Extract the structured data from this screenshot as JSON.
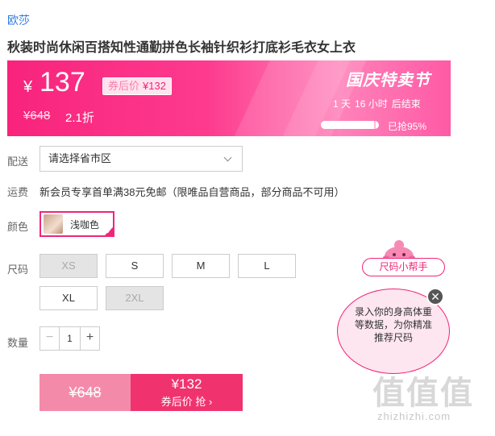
{
  "product": {
    "brand": "欧莎",
    "title": "秋装时尚休闲百搭知性通勤拼色长袖针织衫打底衫毛衣女上衣"
  },
  "price": {
    "currency": "¥",
    "current": "137",
    "coupon_label": "券后价",
    "coupon_price": "¥132",
    "original": "¥648",
    "discount": "2.1折"
  },
  "promo": {
    "festival": "国庆特卖节",
    "countdown_days": "1 天",
    "countdown_hours": "16 小时",
    "countdown_suffix": "后结束",
    "sold_percent": 95,
    "sold_text": "已抢95%"
  },
  "delivery": {
    "label": "配送",
    "select_value": "请选择省市区"
  },
  "shipping": {
    "label": "运费",
    "text": "新会员专享首单满38元免邮（限唯品自营商品，部分商品不可用）"
  },
  "color": {
    "label": "颜色",
    "selected": "浅咖色"
  },
  "sizes": {
    "label": "尺码",
    "options": [
      {
        "label": "XS",
        "disabled": true
      },
      {
        "label": "S",
        "disabled": false
      },
      {
        "label": "M",
        "disabled": false
      },
      {
        "label": "L",
        "disabled": false
      },
      {
        "label": "XL",
        "disabled": false
      },
      {
        "label": "2XL",
        "disabled": true
      }
    ]
  },
  "quantity": {
    "label": "数量",
    "value": "1",
    "minus": "−",
    "plus": "+"
  },
  "buy": {
    "original_price": "¥648",
    "coupon_price": "¥132",
    "coupon_action": "券后价 抢 ›"
  },
  "size_helper": {
    "tag": "尺码小帮手",
    "text": "录入你的身高体重等数据，为你精准推荐尺码",
    "close": "✕"
  },
  "watermark": {
    "text": "值值值",
    "url": "zhizhizhi.com"
  },
  "colors": {
    "accent": "#f0257a",
    "brand_link": "#2c7be5"
  }
}
